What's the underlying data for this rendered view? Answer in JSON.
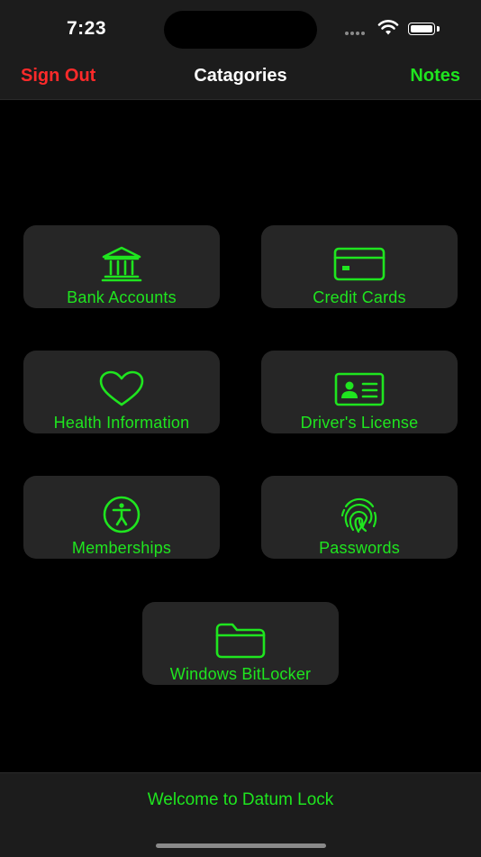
{
  "status_bar": {
    "time": "7:23"
  },
  "nav": {
    "left_label": "Sign Out",
    "title": "Catagories",
    "right_label": "Notes"
  },
  "categories": [
    {
      "label": "Bank Accounts",
      "icon": "bank-icon"
    },
    {
      "label": "Credit Cards",
      "icon": "credit-card-icon"
    },
    {
      "label": "Health Information",
      "icon": "heart-icon"
    },
    {
      "label": "Driver's License",
      "icon": "id-card-icon"
    },
    {
      "label": "Memberships",
      "icon": "accessibility-person-icon"
    },
    {
      "label": "Passwords",
      "icon": "fingerprint-icon"
    },
    {
      "label": "Windows BitLocker",
      "icon": "folder-icon"
    }
  ],
  "footer": {
    "text": "Welcome to Datum Lock"
  },
  "colors": {
    "accent": "#1fe51f",
    "danger": "#ff2a2a",
    "background": "#000000",
    "tile": "#262626",
    "bar": "#1c1c1c"
  }
}
